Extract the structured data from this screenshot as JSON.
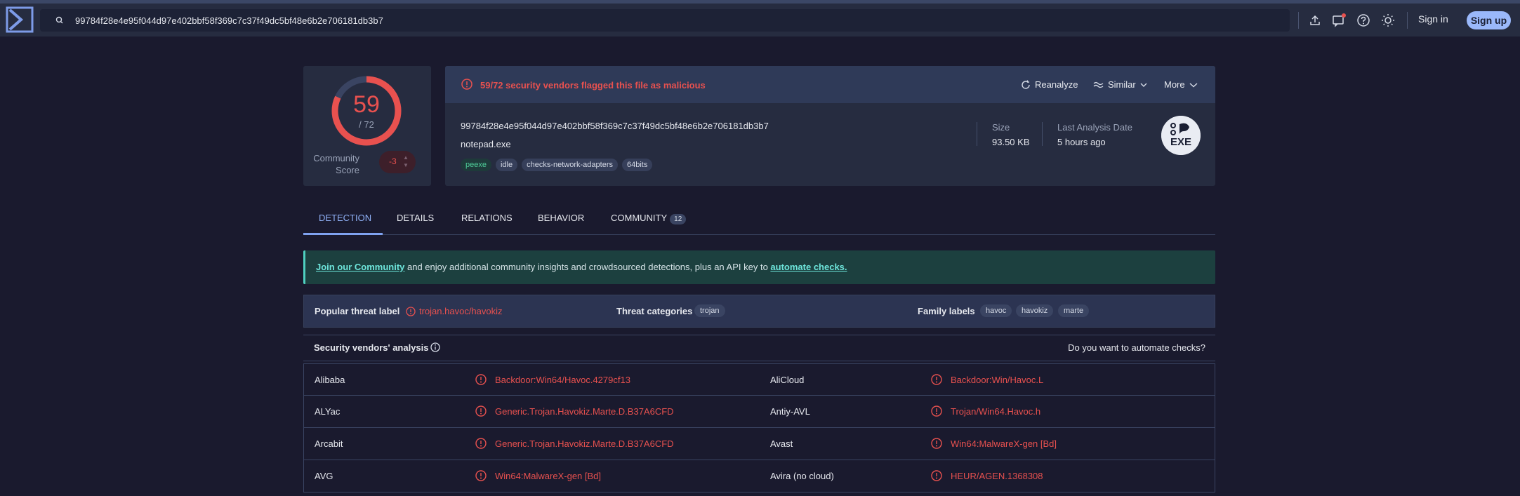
{
  "search": {
    "query": "99784f28e4e95f044d97e402bbf58f369c7c37f49dc5bf48e6b2e706181db3b7"
  },
  "header": {
    "signin": "Sign in",
    "signup": "Sign up"
  },
  "score": {
    "detected": "59",
    "total": "/ 72",
    "detected_count": 59,
    "total_count": 72,
    "community_label": "Community Score",
    "community_value": "-3"
  },
  "alert": {
    "text": "59/72 security vendors flagged this file as malicious"
  },
  "actions": {
    "reanalyze": "Reanalyze",
    "similar": "Similar",
    "more": "More"
  },
  "file": {
    "hash": "99784f28e4e95f044d97e402bbf58f369c7c37f49dc5bf48e6b2e706181db3b7",
    "name": "notepad.exe",
    "tags": [
      "peexe",
      "idle",
      "checks-network-adapters",
      "64bits"
    ],
    "size_label": "Size",
    "size_value": "93.50 KB",
    "last_label": "Last Analysis Date",
    "last_value": "5 hours ago",
    "type_icon_text": "EXE"
  },
  "tabs": [
    "DETECTION",
    "DETAILS",
    "RELATIONS",
    "BEHAVIOR",
    "COMMUNITY"
  ],
  "community_badge": "12",
  "banner": {
    "link1": "Join our Community",
    "middle": " and enjoy additional community insights and crowdsourced detections, plus an API key to ",
    "link2": "automate checks."
  },
  "threat": {
    "popular_label": "Popular threat label",
    "popular_value": "trojan.havoc/havokiz",
    "categories_label": "Threat categories",
    "categories": [
      "trojan"
    ],
    "family_label": "Family labels",
    "families": [
      "havoc",
      "havokiz",
      "marte"
    ]
  },
  "analysis": {
    "title": "Security vendors' analysis",
    "automate": "Do you want to automate checks?"
  },
  "vendors": [
    {
      "left_name": "Alibaba",
      "left_result": "Backdoor:Win64/Havoc.4279cf13",
      "right_name": "AliCloud",
      "right_result": "Backdoor:Win/Havoc.L"
    },
    {
      "left_name": "ALYac",
      "left_result": "Generic.Trojan.Havokiz.Marte.D.B37A6CFD",
      "right_name": "Antiy-AVL",
      "right_result": "Trojan/Win64.Havoc.h"
    },
    {
      "left_name": "Arcabit",
      "left_result": "Generic.Trojan.Havokiz.Marte.D.B37A6CFD",
      "right_name": "Avast",
      "right_result": "Win64:MalwareX-gen [Bd]"
    },
    {
      "left_name": "AVG",
      "left_result": "Win64:MalwareX-gen [Bd]",
      "right_name": "Avira (no cloud)",
      "right_result": "HEUR/AGEN.1368308"
    }
  ]
}
